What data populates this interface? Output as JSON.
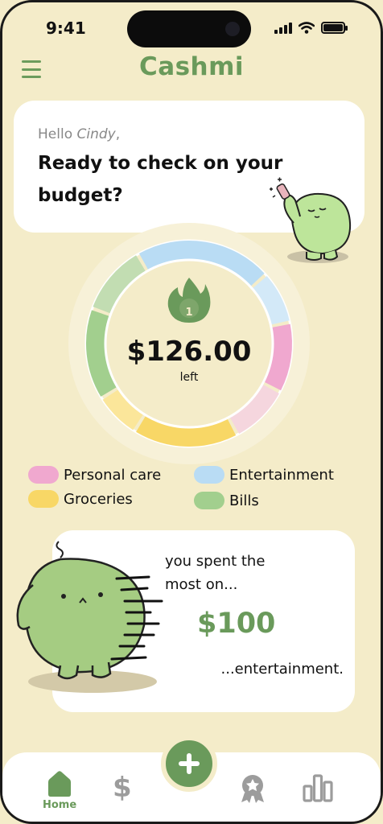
{
  "status": {
    "time": "9:41"
  },
  "header": {
    "title": "Cashmi"
  },
  "greeting": {
    "hello": "Hello ",
    "name": "Cindy",
    "comma": ",",
    "message": "Ready to check on your budget?"
  },
  "budget": {
    "streak": "1",
    "amount": "$126.00",
    "amount_label": "left"
  },
  "chart_data": {
    "type": "pie",
    "categories": [
      "Entertainment",
      "Personal care",
      "Groceries",
      "Bills"
    ],
    "legend": [
      "Personal care",
      "Entertainment",
      "Groceries",
      "Bills"
    ]
  },
  "legend": {
    "personal_care": "Personal care",
    "entertainment": "Entertainment",
    "groceries": "Groceries",
    "bills": "Bills"
  },
  "colors": {
    "accent": "#6a9a5b",
    "background": "#f4ecc9",
    "personal_care": "#f0a8cf",
    "entertainment": "#b9dcf4",
    "groceries": "#f8d766",
    "bills": "#a2cf8e"
  },
  "spending": {
    "line1": "you spent the",
    "line2": "most on...",
    "amount": "$100",
    "category": "...entertainment."
  },
  "nav": {
    "home_label": "Home",
    "icons": [
      "home-icon",
      "dollar-icon",
      "add-icon",
      "award-icon",
      "bar-chart-icon"
    ]
  }
}
